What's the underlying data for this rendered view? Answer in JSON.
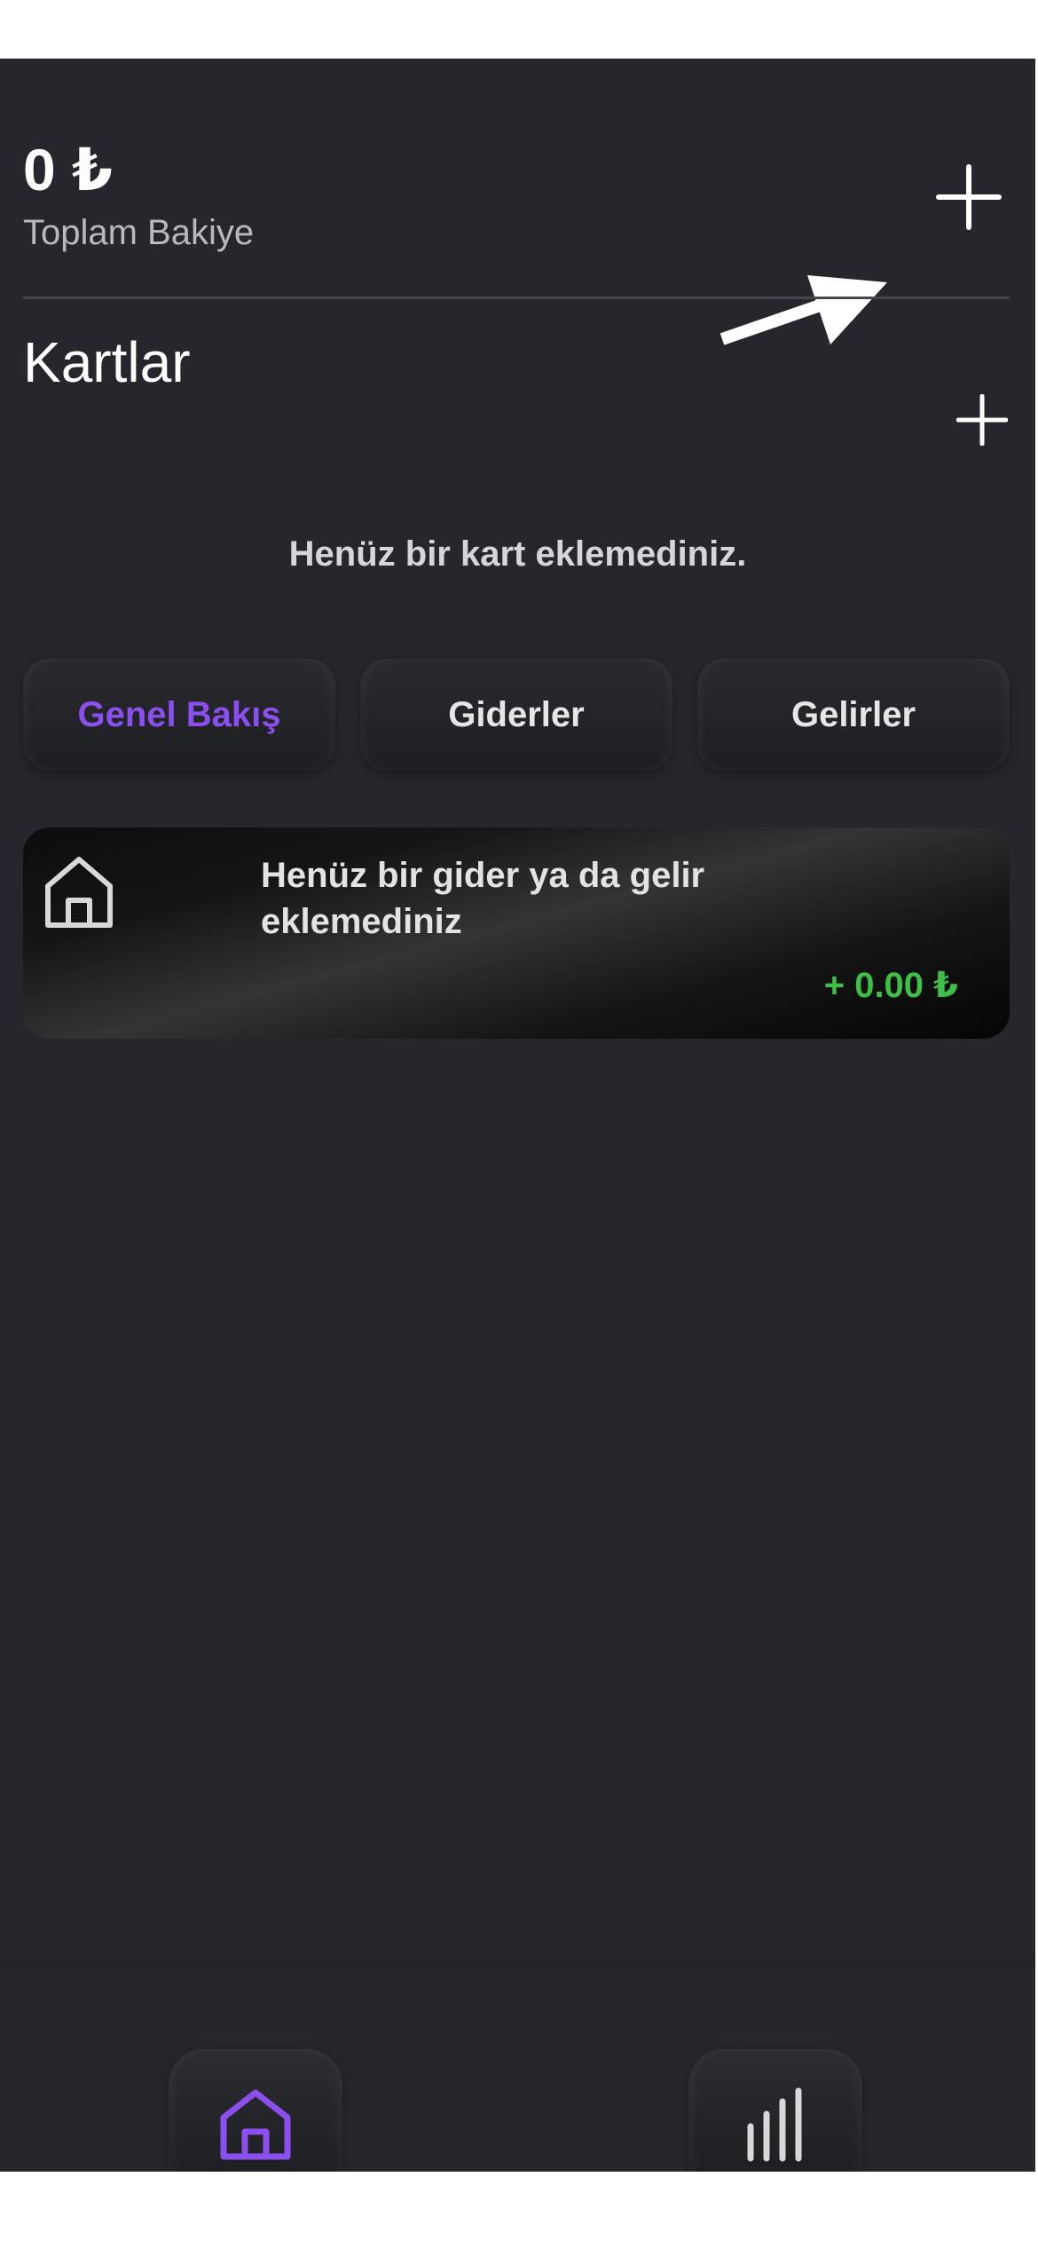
{
  "header": {
    "balance_amount": "0 ₺",
    "balance_label": "Toplam Bakiye",
    "add_icon": "plus-icon"
  },
  "cards": {
    "title": "Kartlar",
    "add_icon": "plus-icon",
    "empty_message": "Henüz bir kart eklemediniz."
  },
  "tabs": [
    {
      "label": "Genel Bakış",
      "active": true
    },
    {
      "label": "Giderler",
      "active": false
    },
    {
      "label": "Gelirler",
      "active": false
    }
  ],
  "transaction_card": {
    "icon": "home-icon",
    "title": "Henüz bir gider ya da gelir eklemediniz",
    "amount": "+ 0.00 ₺"
  },
  "bottom_nav": [
    {
      "name": "home",
      "icon": "home-icon",
      "active": true
    },
    {
      "name": "statistics",
      "icon": "bar-chart-icon",
      "active": false
    }
  ],
  "colors": {
    "background": "#25272c",
    "accent": "#8b4ff0",
    "positive": "#3fbf47",
    "text_primary": "#ffffff",
    "text_secondary": "#b9babd"
  }
}
